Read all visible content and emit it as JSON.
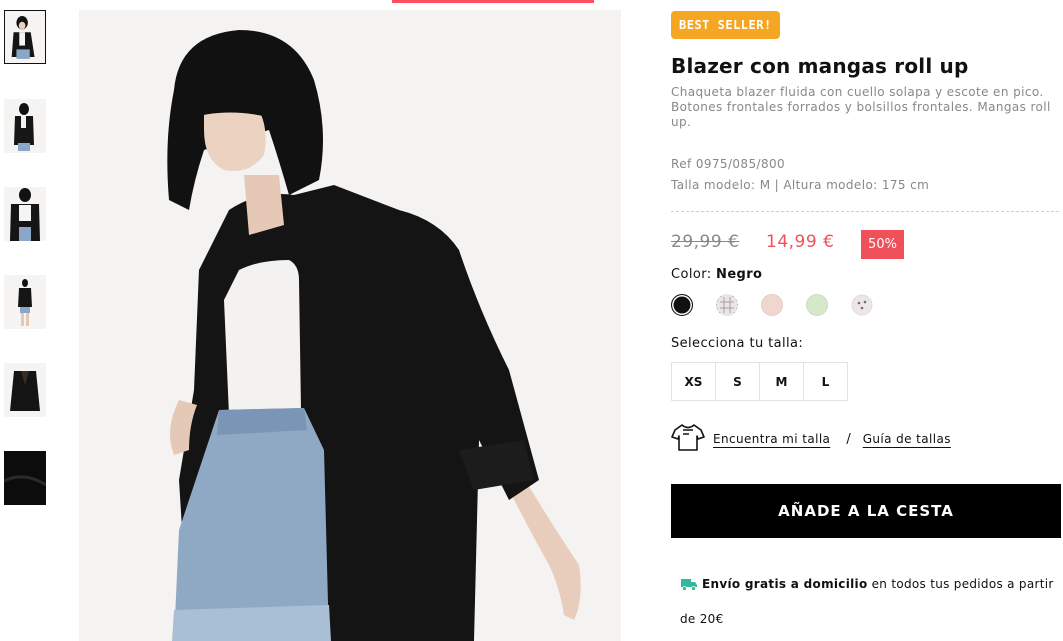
{
  "product": {
    "badge": "BEST SELLER!",
    "title": "Blazer con mangas roll up",
    "description": "Chaqueta blazer fluida con cuello solapa y escote en pico. Botones frontales forrados y bolsillos frontales. Mangas roll up.",
    "ref": "Ref 0975/085/800",
    "model_info": "Talla modelo: M | Altura modelo: 175 cm"
  },
  "price": {
    "old": "29,99 €",
    "current": "14,99 €",
    "discount": "50%"
  },
  "colors": {
    "label": "Color:",
    "selected": "Negro",
    "swatches": [
      {
        "name": "black",
        "hex": "#111111"
      },
      {
        "name": "check",
        "hex": "#e2dada"
      },
      {
        "name": "pink",
        "hex": "#f1d6cf"
      },
      {
        "name": "sage",
        "hex": "#d6e8cc"
      },
      {
        "name": "dots",
        "hex": "#ece6e6"
      }
    ]
  },
  "sizes": {
    "label": "Selecciona tu talla:",
    "options": [
      "XS",
      "S",
      "M",
      "L"
    ]
  },
  "fit": {
    "icon": "tshirt-icon",
    "find_size": "Encuentra mi talla",
    "separator": "/",
    "size_guide": "Guía de tallas"
  },
  "cart": {
    "add_label": "AÑADE A LA CESTA"
  },
  "shipping": {
    "icon": "truck-icon",
    "bold": "Envío gratis a domicilio",
    "rest": "en todos tus pedidos a partir de 20€"
  },
  "gallery": {
    "thumbnail_count": 6,
    "active_index": 0
  },
  "accent_color": "#f0505a"
}
